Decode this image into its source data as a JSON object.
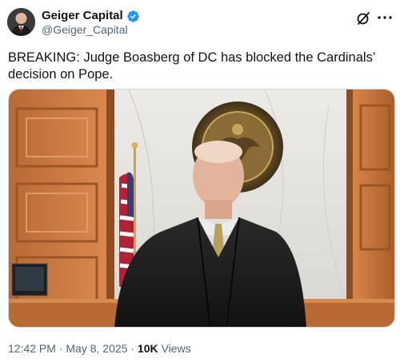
{
  "author": {
    "display_name": "Geiger Capital",
    "handle": "@Geiger_Capital",
    "verified": true
  },
  "tweet": {
    "text": "BREAKING: Judge Boasberg of DC has blocked the Cardinals’ decision on Pope."
  },
  "meta": {
    "time": "12:42 PM",
    "separator": "·",
    "date": "May 8, 2025",
    "views_count": "10K",
    "views_label": "Views"
  },
  "icons": {
    "verified": "verified-badge-icon",
    "grok": "grok-icon",
    "more": "more-icon"
  },
  "colors": {
    "verified_blue": "#1d9bf0",
    "text_primary": "#0f1419",
    "text_secondary": "#536471"
  }
}
